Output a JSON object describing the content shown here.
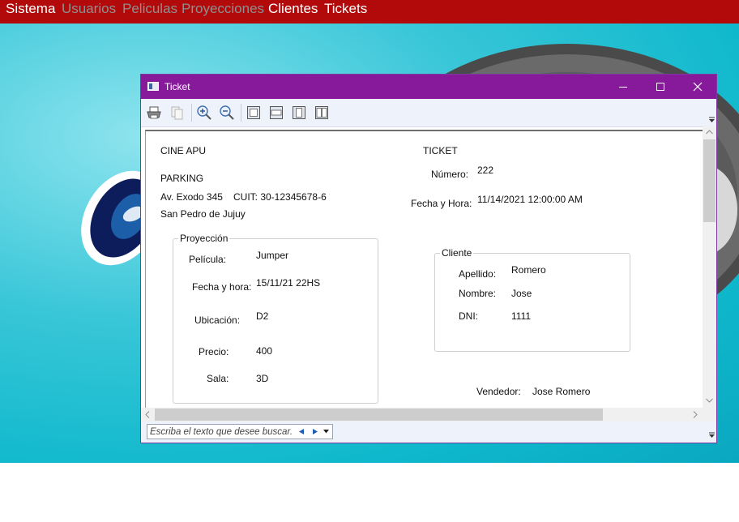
{
  "menu": {
    "items": [
      {
        "label": "Sistema",
        "enabled": true
      },
      {
        "label": "Usuarios",
        "enabled": false
      },
      {
        "label": "Peliculas",
        "enabled": false
      },
      {
        "label": "Proyecciones",
        "enabled": false
      },
      {
        "label": "Clientes",
        "enabled": true
      },
      {
        "label": "Tickets",
        "enabled": true
      }
    ]
  },
  "colors": {
    "menu_bar": "#b20a0a",
    "window_titlebar": "#871a9b",
    "background": "#1cbdd1"
  },
  "window": {
    "title": "Ticket",
    "controls": [
      "minimize-icon",
      "maximize-icon",
      "close-icon"
    ]
  },
  "toolbar": {
    "icons": [
      "print-icon",
      "copy-icon",
      "zoom-in-icon",
      "zoom-out-icon",
      "whole-page-icon",
      "page-width-icon",
      "one-page-icon",
      "two-pages-icon"
    ]
  },
  "ticket": {
    "company": "CINE APU",
    "branch": "PARKING",
    "address": "Av. Exodo 345",
    "cuit": "CUIT: 30-12345678-6",
    "city": "San Pedro de Jujuy",
    "heading": "TICKET",
    "numero_label": "Número:",
    "numero_value": "222",
    "fecha_label": "Fecha y Hora:",
    "fecha_value": "11/14/2021 12:00:00 AM",
    "proyeccion": {
      "title": "Proyección",
      "pelicula_label": "Película:",
      "pelicula_value": "Jumper",
      "fecha_label": "Fecha y hora:",
      "fecha_value": "15/11/21 22HS",
      "ubicacion_label": "Ubicación:",
      "ubicacion_value": "D2",
      "precio_label": "Precio:",
      "precio_value": "400",
      "sala_label": "Sala:",
      "sala_value": "3D"
    },
    "cliente": {
      "title": "Cliente",
      "apellido_label": "Apellido:",
      "apellido_value": "Romero",
      "nombre_label": "Nombre:",
      "nombre_value": "Jose",
      "dni_label": "DNI:",
      "dni_value": "1111"
    },
    "vendedor_label": "Vendedor:",
    "vendedor_value": "Jose Romero"
  },
  "search": {
    "placeholder": "Escriba el texto que desee buscar..."
  }
}
